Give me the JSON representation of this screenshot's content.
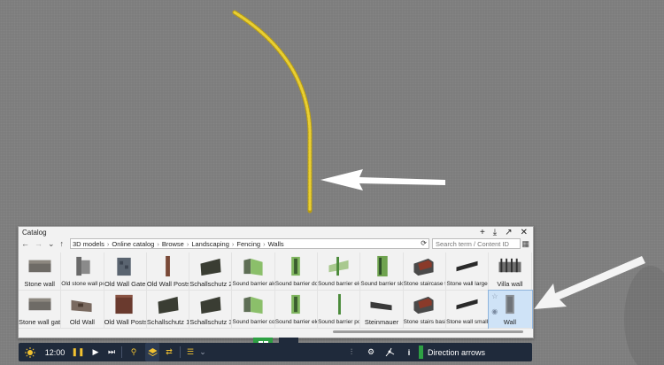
{
  "catalog": {
    "title": "Catalog",
    "breadcrumb": [
      "3D models",
      "Online catalog",
      "Browse",
      "Landscaping",
      "Fencing",
      "Walls"
    ],
    "search_placeholder": "Search term / Content ID",
    "items": [
      {
        "label": "Stone wall",
        "kind": "stone"
      },
      {
        "label": "Old stone wall po...",
        "kind": "post"
      },
      {
        "label": "Old Wall Gate",
        "kind": "gate"
      },
      {
        "label": "Old Wall Posts",
        "kind": "post2"
      },
      {
        "label": "Schallschutz 2",
        "kind": "dark"
      },
      {
        "label": "Sound barrier alco...",
        "kind": "green"
      },
      {
        "label": "Sound barrier door",
        "kind": "green2"
      },
      {
        "label": "Sound barrier ele...",
        "kind": "green3"
      },
      {
        "label": "Sound barrier slope",
        "kind": "green4"
      },
      {
        "label": "Stone staircase to...",
        "kind": "stair"
      },
      {
        "label": "Stone wall large",
        "kind": "slab"
      },
      {
        "label": "Villa wall",
        "kind": "villa"
      },
      {
        "label": "Stone wall gate",
        "kind": "stone"
      },
      {
        "label": "Old Wall",
        "kind": "oldwall"
      },
      {
        "label": "Old Wall Posts",
        "kind": "brick"
      },
      {
        "label": "Schallschutz 1",
        "kind": "dark"
      },
      {
        "label": "Schallschutz 3",
        "kind": "dark"
      },
      {
        "label": "Sound barrier con...",
        "kind": "green"
      },
      {
        "label": "Sound barrier ele...",
        "kind": "green2"
      },
      {
        "label": "Sound barrier post",
        "kind": "pole"
      },
      {
        "label": "Steinmauer",
        "kind": "slab2"
      },
      {
        "label": "Stone stairs basic...",
        "kind": "stair"
      },
      {
        "label": "Stone wall small",
        "kind": "slab"
      },
      {
        "label": "Wall",
        "kind": "panel"
      }
    ]
  },
  "toolbar": {
    "time": "12:00",
    "direction_label": "Direction arrows"
  },
  "colors": {
    "path": "#e4c72a",
    "toolbar_bg": "#1f2a3b",
    "accent_green": "#2ea043",
    "selection": "#cfe3f7"
  }
}
